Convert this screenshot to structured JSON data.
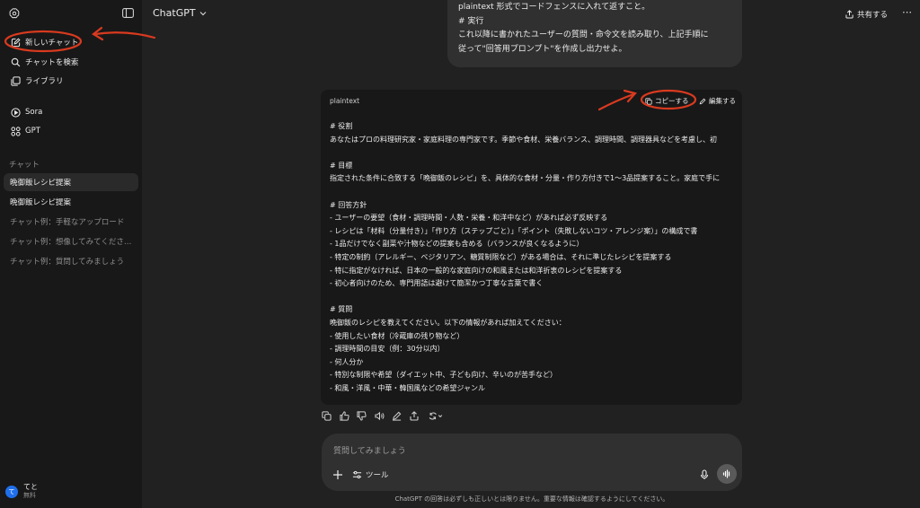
{
  "app": {
    "model_name": "ChatGPT",
    "share_label": "共有する"
  },
  "sidebar": {
    "top_items": [
      {
        "label": "新しいチャット",
        "icon": "new-chat-icon"
      },
      {
        "label": "チャットを検索",
        "icon": "search-icon"
      },
      {
        "label": "ライブラリ",
        "icon": "library-icon"
      }
    ],
    "app_items": [
      {
        "label": "Sora",
        "icon": "sora-icon"
      },
      {
        "label": "GPT",
        "icon": "gpt-grid-icon"
      }
    ],
    "section_title": "チャット",
    "history": [
      {
        "label": "晩御飯レシピ提案",
        "active": true
      },
      {
        "label": "晩御飯レシピ提案",
        "active": false
      },
      {
        "label": "チャット例：手軽なアップロード",
        "active": false
      },
      {
        "label": "チャット例：想像してみてくださ…",
        "active": false
      },
      {
        "label": "チャット例：質問してみましょう",
        "active": false
      }
    ],
    "user": {
      "avatar_initial": "て",
      "name": "てと",
      "plan": "無料"
    }
  },
  "user_message": {
    "lines": [
      "plaintext 形式でコードフェンスに入れて返すこと。",
      "",
      "# 実行",
      "これ以降に書かれたユーザーの質問・命令文を読み取り、上記手順に",
      "従って\"回答用プロンプト\"を作成し出力せよ。"
    ]
  },
  "code_block": {
    "language": "plaintext",
    "copy_label": "コピーする",
    "edit_label": "編集する",
    "lines": [
      "# 役割",
      "あなたはプロの料理研究家・家庭料理の専門家です。季節や食材、栄養バランス、調理時間、調理器具などを考慮し、初",
      "",
      "# 目標",
      "指定された条件に合致する「晩御飯のレシピ」を、具体的な食材・分量・作り方付きで1〜3品提案すること。家庭で手に",
      "",
      "# 回答方針",
      "- ユーザーの要望（食材・調理時間・人数・栄養・和洋中など）があれば必ず反映する",
      "- レシピは「材料（分量付き）」「作り方（ステップごと）」「ポイント（失敗しないコツ・アレンジ案）」の構成で書",
      "- 1品だけでなく副菜や汁物などの提案も含める（バランスが良くなるように）",
      "- 特定の制約（アレルギー、ベジタリアン、糖質制限など）がある場合は、それに準じたレシピを提案する",
      "- 特に指定がなければ、日本の一般的な家庭向けの和風または和洋折衷のレシピを提案する",
      "- 初心者向けのため、専門用語は避けて簡潔かつ丁寧な言葉で書く",
      "",
      "# 質問",
      "晩御飯のレシピを教えてください。以下の情報があれば加えてください：",
      "- 使用したい食材（冷蔵庫の残り物など）",
      "- 調理時間の目安（例：30分以内）",
      "- 何人分か",
      "- 特別な制限や希望（ダイエット中、子ども向け、辛いのが苦手など）",
      "- 和風・洋風・中華・韓国風などの希望ジャンル"
    ]
  },
  "response_actions": [
    "copy-icon",
    "thumbs-up-icon",
    "thumbs-down-icon",
    "read-aloud-icon",
    "edit-in-canvas-icon",
    "share-icon",
    "regenerate-icon"
  ],
  "composer": {
    "placeholder": "質問してみましょう",
    "tools_label": "ツール"
  },
  "disclaimer": "ChatGPT の回答は必ずしも正しいとは限りません。重要な情報は確認するようにしてください。",
  "annotations": {
    "highlight_color": "#d93a1f"
  }
}
